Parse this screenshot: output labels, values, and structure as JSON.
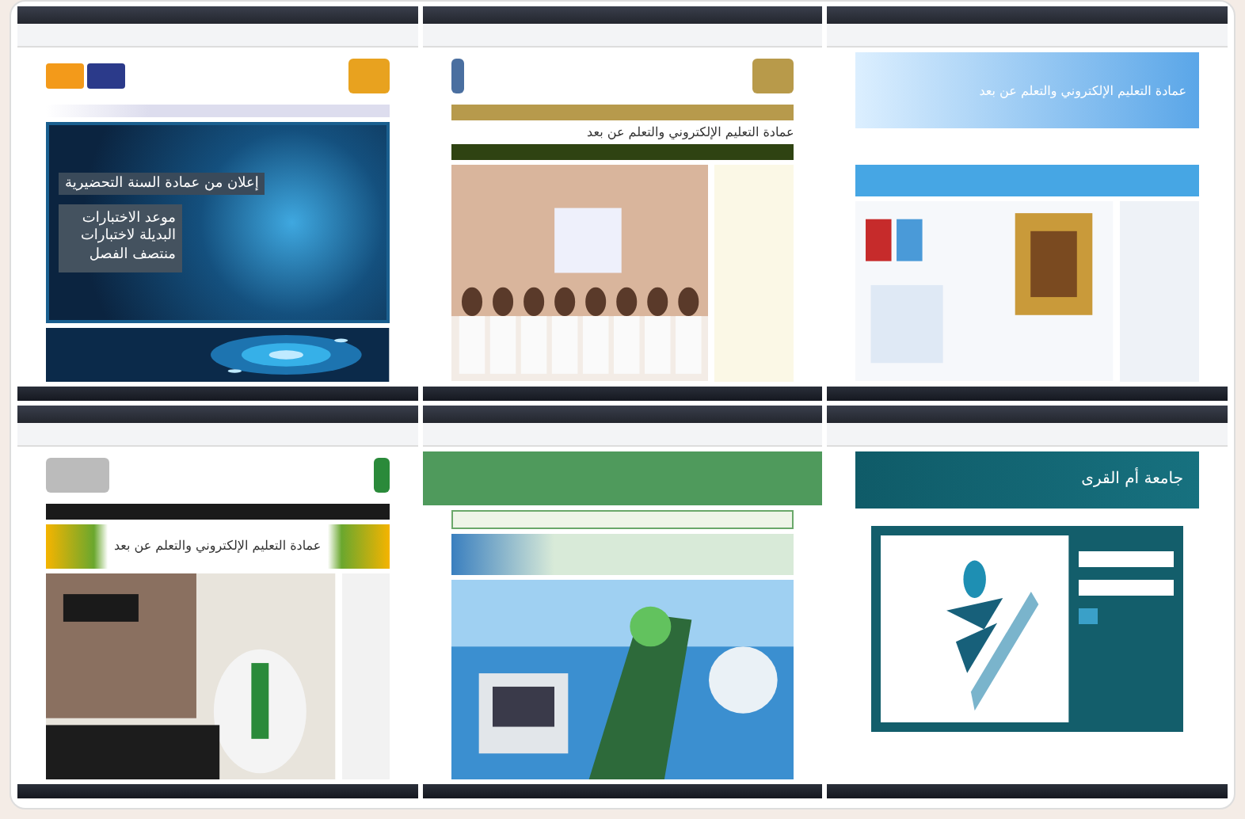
{
  "windows": [
    {
      "kind": "blue-portal",
      "banner_title": "إعلان من عمادة السنة التحضيرية",
      "banner_text": "موعد الاختبارات البديلة لاختبارات منتصف الفصل"
    },
    {
      "kind": "gold-portal",
      "heading": "عمادة التعليم الإلكتروني والتعلم عن بعد"
    },
    {
      "kind": "sky-portal",
      "heading": "عمادة التعليم الإلكتروني والتعلم عن بعد"
    },
    {
      "kind": "green-portal",
      "heading": "عمادة التعليم الإلكتروني والتعلم عن بعد"
    },
    {
      "kind": "olive-portal"
    },
    {
      "kind": "login-portal",
      "heading": "جامعة أم القرى"
    }
  ]
}
